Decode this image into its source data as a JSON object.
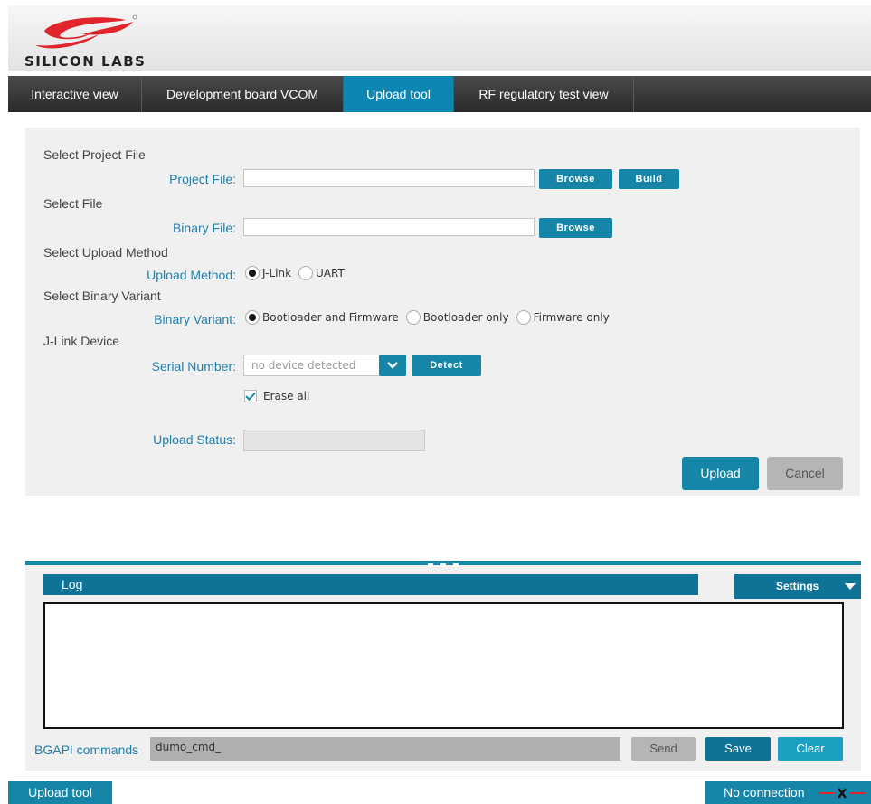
{
  "brand": {
    "name": "SILICON LABS",
    "logo_color": "#e0262c"
  },
  "tabs": [
    {
      "label": "Interactive view"
    },
    {
      "label": "Development board VCOM"
    },
    {
      "label": "Upload tool"
    },
    {
      "label": "RF regulatory test view"
    }
  ],
  "form": {
    "project_section": "Select Project File",
    "project_label": "Project File:",
    "project_value": "",
    "project_browse": "Browse",
    "project_build": "Build",
    "file_section": "Select File",
    "binary_label": "Binary File:",
    "binary_value": "",
    "binary_browse": "Browse",
    "method_section": "Select Upload Method",
    "method_label": "Upload Method:",
    "method_options": [
      "J-Link",
      "UART"
    ],
    "variant_section": "Select Binary Variant",
    "variant_label": "Binary Variant:",
    "variant_options": [
      "Bootloader and Firmware",
      "Bootloader only",
      "Firmware only"
    ],
    "jlink_section": "J-Link Device",
    "serial_label": "Serial Number:",
    "serial_value": "no device detected",
    "detect_label": "Detect",
    "erase_label": "Erase all",
    "status_label": "Upload Status:",
    "upload_label": "Upload",
    "cancel_label": "Cancel"
  },
  "log": {
    "title": "Log",
    "settings_label": "Settings",
    "commands_label": "BGAPI commands",
    "command_value": "dumo_cmd_",
    "send_label": "Send",
    "save_label": "Save",
    "clear_label": "Clear"
  },
  "statusbar": {
    "left": "Upload tool",
    "right": "No connection"
  },
  "colors": {
    "accent": "#1586a8",
    "active_tab": "#0e86b4",
    "nav_bg": "#333333",
    "panel_bg": "#f0f0f0"
  }
}
